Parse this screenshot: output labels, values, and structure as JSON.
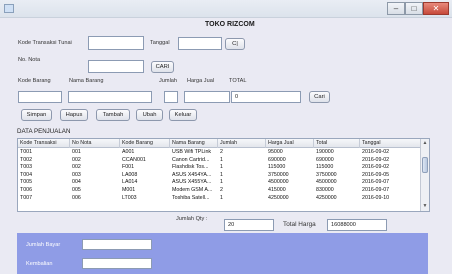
{
  "window": {
    "title": "",
    "minimize": "–",
    "maximize": "□",
    "close": "✕",
    "icon": "app-window-icon"
  },
  "form": {
    "heading": "TOKO RIZCOM",
    "kode_transaksi_label": "Kode Transaksi Tunai",
    "kode_transaksi_value": "",
    "tanggal_label": "Tanggal",
    "tanggal_value": "",
    "tanggal_button": "C|",
    "no_nota_label": "No. Nota",
    "no_nota_value": "",
    "cari_nota_button": "CARI",
    "kode_barang_label": "Kode Barang",
    "nama_barang_label": "Nama Barang",
    "jumlah_label": "Jumlah",
    "harga_jual_label": "Harga Jual",
    "total_label": "TOTAL",
    "kode_barang_value": "",
    "nama_barang_value": "",
    "jumlah_value": "",
    "harga_jual_value": "",
    "total_value": "0",
    "cari_barang_button": "Cari"
  },
  "actions": [
    "Simpan",
    "Hapus",
    "Tambah",
    "Ubah",
    "Keluar"
  ],
  "table": {
    "section_label": "DATA PENJUALAN",
    "columns": [
      "Kode Transaksi",
      "No Nota",
      "Kode Barang",
      "Nama Barang",
      "Jumlah",
      "Harga Jual",
      "Total",
      "Tanggal"
    ],
    "rows": [
      [
        "T001",
        "001",
        "A001",
        "USB Wifi TPLink",
        "2",
        "95000",
        "190000",
        "2016-09-02"
      ],
      [
        "T002",
        "002",
        "CCAN001",
        "Canon Cartrid...",
        "1",
        "690000",
        "690000",
        "2016-09-02"
      ],
      [
        "T003",
        "002",
        "F001",
        "Flashdisk Tos...",
        "1",
        "115000",
        "115000",
        "2016-09-02"
      ],
      [
        "T004",
        "003",
        "LA008",
        "ASUS X454YA...",
        "1",
        "3750000",
        "3750000",
        "2016-09-05"
      ],
      [
        "T005",
        "004",
        "LA014",
        "ASUS X455YA...",
        "1",
        "4500000",
        "4500000",
        "2016-09-07"
      ],
      [
        "T006",
        "005",
        "M001",
        "Modem GSM A...",
        "2",
        "415000",
        "830000",
        "2016-09-07"
      ],
      [
        "T007",
        "006",
        "LT003",
        "Toshiba Satell...",
        "1",
        "4250000",
        "4250000",
        "2016-09-10"
      ]
    ]
  },
  "summary": {
    "jumlah_qty_label": "Jumlah Qty :",
    "jumlah_qty_value": "20",
    "total_harga_label": "Total Harga",
    "total_harga_value": "16088000"
  },
  "payment": {
    "jumlah_bayar_label": "Jumlah Bayar",
    "jumlah_bayar_value": "",
    "kembalian_label": "Kembalian",
    "kembalian_value": ""
  },
  "colors": {
    "form_bg": "#eaeaf3",
    "bottom_panel": "#8f9ce6",
    "close_button": "#c6493a"
  }
}
